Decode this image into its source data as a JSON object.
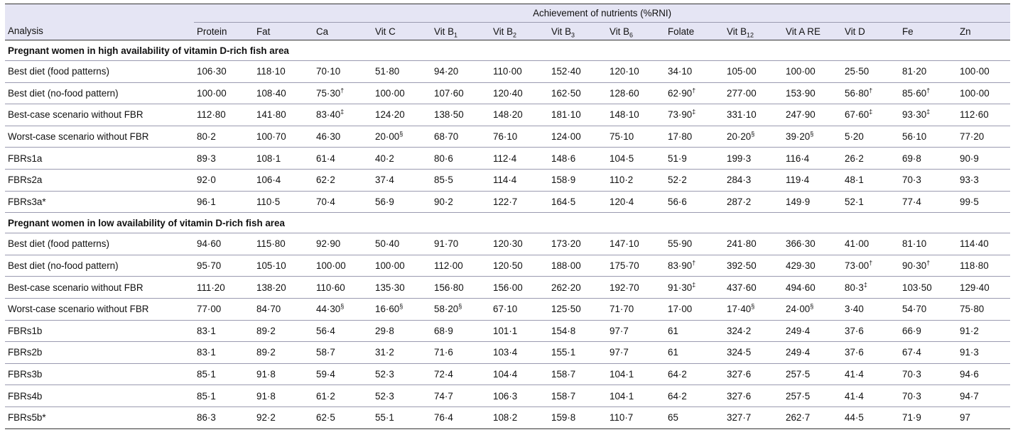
{
  "table": {
    "group_header": "Achievement of nutrients (%RNI)",
    "columns": [
      {
        "label": "Analysis"
      },
      {
        "label": "Protein"
      },
      {
        "label": "Fat"
      },
      {
        "label": "Ca"
      },
      {
        "label": "Vit C"
      },
      {
        "label": "Vit B",
        "sub": "1"
      },
      {
        "label": "Vit B",
        "sub": "2"
      },
      {
        "label": "Vit B",
        "sub": "3"
      },
      {
        "label": "Vit B",
        "sub": "6"
      },
      {
        "label": "Folate"
      },
      {
        "label": "Vit B",
        "sub": "12"
      },
      {
        "label": "Vit A RE"
      },
      {
        "label": "Vit D"
      },
      {
        "label": "Fe"
      },
      {
        "label": "Zn"
      }
    ],
    "sections": [
      {
        "title": "Pregnant women in high availability of vitamin D-rich fish area",
        "rows": [
          {
            "label": "Best diet (food patterns)",
            "cells": [
              {
                "v": "106·30"
              },
              {
                "v": "118·10"
              },
              {
                "v": "70·10"
              },
              {
                "v": "51·80"
              },
              {
                "v": "94·20"
              },
              {
                "v": "110·00"
              },
              {
                "v": "152·40"
              },
              {
                "v": "120·10"
              },
              {
                "v": "34·10"
              },
              {
                "v": "105·00"
              },
              {
                "v": "100·00"
              },
              {
                "v": "25·50"
              },
              {
                "v": "81·20"
              },
              {
                "v": "100·00"
              }
            ]
          },
          {
            "label": "Best diet (no-food pattern)",
            "cells": [
              {
                "v": "100·00"
              },
              {
                "v": "108·40"
              },
              {
                "v": "75·30",
                "b": true,
                "s": "†"
              },
              {
                "v": "100·00"
              },
              {
                "v": "107·60"
              },
              {
                "v": "120·40"
              },
              {
                "v": "162·50"
              },
              {
                "v": "128·60"
              },
              {
                "v": "62·90",
                "b": true,
                "s": "†"
              },
              {
                "v": "277·00"
              },
              {
                "v": "153·90"
              },
              {
                "v": "56·80",
                "b": true,
                "s": "†"
              },
              {
                "v": "85·60",
                "b": true,
                "s": "†"
              },
              {
                "v": "100·00"
              }
            ]
          },
          {
            "label": "Best-case scenario without FBR",
            "cells": [
              {
                "v": "112·80"
              },
              {
                "v": "141·80"
              },
              {
                "v": "83·40",
                "b": true,
                "s": "‡"
              },
              {
                "v": "124·20"
              },
              {
                "v": "138·50"
              },
              {
                "v": "148·20"
              },
              {
                "v": "181·10"
              },
              {
                "v": "148·10"
              },
              {
                "v": "73·90",
                "b": true,
                "s": "‡"
              },
              {
                "v": "331·10"
              },
              {
                "v": "247·90"
              },
              {
                "v": "67·60",
                "b": true,
                "s": "‡"
              },
              {
                "v": "93·30",
                "b": true,
                "s": "‡"
              },
              {
                "v": "112·60"
              }
            ]
          },
          {
            "label": "Worst-case scenario without FBR",
            "cells": [
              {
                "v": "80·2"
              },
              {
                "v": "100·70"
              },
              {
                "v": "46·30"
              },
              {
                "v": "20·00",
                "b": true,
                "s": "§"
              },
              {
                "v": "68·70"
              },
              {
                "v": "76·10"
              },
              {
                "v": "124·00"
              },
              {
                "v": "75·10"
              },
              {
                "v": "17·80"
              },
              {
                "v": "20·20",
                "b": true,
                "s": "§"
              },
              {
                "v": "39·20",
                "b": true,
                "s": "§"
              },
              {
                "v": "5·20"
              },
              {
                "v": "56·10"
              },
              {
                "v": "77·20"
              }
            ]
          },
          {
            "label": "FBRs1a",
            "cells": [
              {
                "v": "89·3"
              },
              {
                "v": "108·1"
              },
              {
                "v": "61·4"
              },
              {
                "v": "40·2"
              },
              {
                "v": "80·6"
              },
              {
                "v": "112·4"
              },
              {
                "v": "148·6"
              },
              {
                "v": "104·5"
              },
              {
                "v": "51·9"
              },
              {
                "v": "199·3"
              },
              {
                "v": "116·4"
              },
              {
                "v": "26·2"
              },
              {
                "v": "69·8"
              },
              {
                "v": "90·9"
              }
            ]
          },
          {
            "label": "FBRs2a",
            "cells": [
              {
                "v": "92·0"
              },
              {
                "v": "106·4"
              },
              {
                "v": "62·2"
              },
              {
                "v": "37·4"
              },
              {
                "v": "85·5"
              },
              {
                "v": "114·4"
              },
              {
                "v": "158·9"
              },
              {
                "v": "110·2"
              },
              {
                "v": "52·2"
              },
              {
                "v": "284·3"
              },
              {
                "v": "119·4"
              },
              {
                "v": "48·1"
              },
              {
                "v": "70·3"
              },
              {
                "v": "93·3"
              }
            ]
          },
          {
            "label": "FBRs3a*",
            "cells": [
              {
                "v": "96·1"
              },
              {
                "v": "110·5"
              },
              {
                "v": "70·4"
              },
              {
                "v": "56·9"
              },
              {
                "v": "90·2"
              },
              {
                "v": "122·7"
              },
              {
                "v": "164·5"
              },
              {
                "v": "120·4"
              },
              {
                "v": "56·6"
              },
              {
                "v": "287·2"
              },
              {
                "v": "149·9"
              },
              {
                "v": "52·1"
              },
              {
                "v": "77·4"
              },
              {
                "v": "99·5"
              }
            ]
          }
        ]
      },
      {
        "title": "Pregnant women in low availability of vitamin D-rich fish area",
        "rows": [
          {
            "label": "Best diet (food patterns)",
            "cells": [
              {
                "v": "94·60"
              },
              {
                "v": "115·80"
              },
              {
                "v": "92·90"
              },
              {
                "v": "50·40"
              },
              {
                "v": "91·70"
              },
              {
                "v": "120·30"
              },
              {
                "v": "173·20"
              },
              {
                "v": "147·10"
              },
              {
                "v": "55·90"
              },
              {
                "v": "241·80"
              },
              {
                "v": "366·30"
              },
              {
                "v": "41·00"
              },
              {
                "v": "81·10"
              },
              {
                "v": "114·40"
              }
            ]
          },
          {
            "label": "Best diet (no-food pattern)",
            "cells": [
              {
                "v": "95·70"
              },
              {
                "v": "105·10"
              },
              {
                "v": "100·00"
              },
              {
                "v": "100·00"
              },
              {
                "v": "112·00"
              },
              {
                "v": "120·50"
              },
              {
                "v": "188·00"
              },
              {
                "v": "175·70"
              },
              {
                "v": "83·90",
                "b": true,
                "s": "†"
              },
              {
                "v": "392·50"
              },
              {
                "v": "429·30"
              },
              {
                "v": "73·00",
                "b": true,
                "s": "†"
              },
              {
                "v": "90·30",
                "b": true,
                "s": "†"
              },
              {
                "v": "118·80"
              }
            ]
          },
          {
            "label": "Best-case scenario without FBR",
            "cells": [
              {
                "v": "111·20"
              },
              {
                "v": "138·20"
              },
              {
                "v": "110·60"
              },
              {
                "v": "135·30"
              },
              {
                "v": "156·80"
              },
              {
                "v": "156·00"
              },
              {
                "v": "262·20"
              },
              {
                "v": "192·70"
              },
              {
                "v": "91·30",
                "b": true,
                "s": "‡"
              },
              {
                "v": "437·60"
              },
              {
                "v": "494·60"
              },
              {
                "v": "80·3",
                "b": true,
                "s": "‡"
              },
              {
                "v": "103·50"
              },
              {
                "v": "129·40"
              }
            ]
          },
          {
            "label": "Worst-case scenario without FBR",
            "cells": [
              {
                "v": "77·00"
              },
              {
                "v": "84·70"
              },
              {
                "v": "44·30",
                "b": true,
                "s": "§"
              },
              {
                "v": "16·60",
                "b": true,
                "s": "§"
              },
              {
                "v": "58·20",
                "b": true,
                "s": "§"
              },
              {
                "v": "67·10"
              },
              {
                "v": "125·50"
              },
              {
                "v": "71·70"
              },
              {
                "v": "17·00"
              },
              {
                "v": "17·40",
                "b": true,
                "s": "§"
              },
              {
                "v": "24·00",
                "b": true,
                "s": "§"
              },
              {
                "v": "3·40"
              },
              {
                "v": "54·70"
              },
              {
                "v": "75·80"
              }
            ]
          },
          {
            "label": "FBRs1b",
            "cells": [
              {
                "v": "83·1"
              },
              {
                "v": "89·2"
              },
              {
                "v": "56·4"
              },
              {
                "v": "29·8"
              },
              {
                "v": "68·9"
              },
              {
                "v": "101·1"
              },
              {
                "v": "154·8"
              },
              {
                "v": "97·7"
              },
              {
                "v": "61"
              },
              {
                "v": "324·2"
              },
              {
                "v": "249·4"
              },
              {
                "v": "37·6"
              },
              {
                "v": "66·9"
              },
              {
                "v": "91·2"
              }
            ]
          },
          {
            "label": "FBRs2b",
            "cells": [
              {
                "v": "83·1"
              },
              {
                "v": "89·2"
              },
              {
                "v": "58·7"
              },
              {
                "v": "31·2"
              },
              {
                "v": "71·6"
              },
              {
                "v": "103·4"
              },
              {
                "v": "155·1"
              },
              {
                "v": "97·7"
              },
              {
                "v": "61"
              },
              {
                "v": "324·5"
              },
              {
                "v": "249·4"
              },
              {
                "v": "37·6"
              },
              {
                "v": "67·4"
              },
              {
                "v": "91·3"
              }
            ]
          },
          {
            "label": "FBRs3b",
            "cells": [
              {
                "v": "85·1"
              },
              {
                "v": "91·8"
              },
              {
                "v": "59·4"
              },
              {
                "v": "52·3"
              },
              {
                "v": "72·4"
              },
              {
                "v": "104·4"
              },
              {
                "v": "158·7"
              },
              {
                "v": "104·1"
              },
              {
                "v": "64·2"
              },
              {
                "v": "327·6"
              },
              {
                "v": "257·5"
              },
              {
                "v": "41·4"
              },
              {
                "v": "70·3"
              },
              {
                "v": "94·6"
              }
            ]
          },
          {
            "label": "FBRs4b",
            "cells": [
              {
                "v": "85·1"
              },
              {
                "v": "91·8"
              },
              {
                "v": "61·2"
              },
              {
                "v": "52·3"
              },
              {
                "v": "74·7"
              },
              {
                "v": "106·3"
              },
              {
                "v": "158·7"
              },
              {
                "v": "104·1"
              },
              {
                "v": "64·2"
              },
              {
                "v": "327·6"
              },
              {
                "v": "257·5"
              },
              {
                "v": "41·4"
              },
              {
                "v": "70·3"
              },
              {
                "v": "94·7"
              }
            ]
          },
          {
            "label": "FBRs5b*",
            "cells": [
              {
                "v": "86·3"
              },
              {
                "v": "92·2"
              },
              {
                "v": "62·5"
              },
              {
                "v": "55·1"
              },
              {
                "v": "76·4"
              },
              {
                "v": "108·2"
              },
              {
                "v": "159·8"
              },
              {
                "v": "110·7"
              },
              {
                "v": "65"
              },
              {
                "v": "327·7"
              },
              {
                "v": "262·7"
              },
              {
                "v": "44·5"
              },
              {
                "v": "71·9"
              },
              {
                "v": "97"
              }
            ]
          }
        ]
      }
    ]
  }
}
